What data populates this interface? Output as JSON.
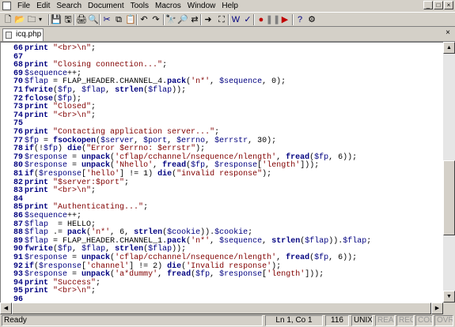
{
  "menu": [
    "File",
    "Edit",
    "Search",
    "Document",
    "Tools",
    "Macros",
    "Window",
    "Help"
  ],
  "window_controls": [
    "_",
    "□",
    "×"
  ],
  "tab": {
    "label": "icq.php",
    "close": "×"
  },
  "toolbar": {
    "icons": [
      "new-file-icon",
      "open-folder-icon",
      "open-project-icon",
      "open-dropdown-icon",
      "save-icon",
      "save-all-icon",
      "print-icon",
      "print-preview-icon",
      "cut-icon",
      "copy-icon",
      "paste-icon",
      "undo-icon",
      "redo-icon",
      "find-icon",
      "find-next-icon",
      "replace-icon",
      "goto-icon",
      "fullscreen-icon",
      "word-wrap-icon",
      "spell-check-icon",
      "record-macro-icon",
      "pause-macro-icon",
      "play-macro-icon",
      "help-icon",
      "settings-icon"
    ],
    "glyphs": [
      "🗋",
      "📂",
      "🗀",
      "▾",
      "💾",
      "🖫",
      "🖨",
      "🔍",
      "✂",
      "⧉",
      "📋",
      "↶",
      "↷",
      "🔭",
      "🔎",
      "⇄",
      "➜",
      "⛶",
      "W",
      "✓",
      "●",
      "❚❚",
      "▶",
      "?",
      "⚙"
    ]
  },
  "code_lines": [
    {
      "n": "66",
      "code": "print \"<br>\\n\";"
    },
    {
      "n": "67",
      "code": ""
    },
    {
      "n": "68",
      "code": "print \"Closing connection...\";"
    },
    {
      "n": "69",
      "code": "$sequence++;"
    },
    {
      "n": "70",
      "code": "$flap = FLAP_HEADER.CHANNEL_4.pack('n*', $sequence, 0);"
    },
    {
      "n": "71",
      "code": "fwrite($fp, $flap, strlen($flap));"
    },
    {
      "n": "72",
      "code": "fclose($fp);"
    },
    {
      "n": "73",
      "code": "print \"Closed\";"
    },
    {
      "n": "74",
      "code": "print \"<br>\\n\";"
    },
    {
      "n": "75",
      "code": ""
    },
    {
      "n": "76",
      "code": "print \"Contacting application server...\";"
    },
    {
      "n": "77",
      "code": "$fp = fsockopen($server, $port, $errno, $errstr, 30);"
    },
    {
      "n": "78",
      "code": "if(!$fp) die(\"Error $errno: $errstr\");"
    },
    {
      "n": "79",
      "code": "$response = unpack('cflap/cchannel/nsequence/nlength', fread($fp, 6));"
    },
    {
      "n": "80",
      "code": "$response = unpack('Nhello', fread($fp, $response['length']));"
    },
    {
      "n": "81",
      "code": "if($response['hello'] != 1) die(\"invalid response\");"
    },
    {
      "n": "82",
      "code": "print \"$server:$port\";"
    },
    {
      "n": "83",
      "code": "print \"<br>\\n\";"
    },
    {
      "n": "84",
      "code": ""
    },
    {
      "n": "85",
      "code": "print \"Authenticating...\";"
    },
    {
      "n": "86",
      "code": "$sequence++;"
    },
    {
      "n": "87",
      "code": "$flap  = HELLO;"
    },
    {
      "n": "88",
      "code": "$flap .= pack('n*', 6, strlen($cookie)).$cookie;"
    },
    {
      "n": "89",
      "code": "$flap = FLAP_HEADER.CHANNEL_1.pack('n*', $sequence, strlen($flap)).$flap;"
    },
    {
      "n": "90",
      "code": "fwrite($fp, $flap, strlen($flap));"
    },
    {
      "n": "91",
      "code": "$response = unpack('cflap/cchannel/nsequence/nlength', fread($fp, 6));"
    },
    {
      "n": "92",
      "code": "if($response['channel'] != 2) die('Invalid response');"
    },
    {
      "n": "93",
      "code": "$response = unpack('a*dummy', fread($fp, $response['length']));"
    },
    {
      "n": "94",
      "code": "print \"Success\";"
    },
    {
      "n": "95",
      "code": "print \"<br>\\n\";"
    },
    {
      "n": "96",
      "code": ""
    }
  ],
  "status": {
    "ready": "Ready",
    "position": "Ln 1, Co 1",
    "chars": "116",
    "unix": "UNIX",
    "read": "READ",
    "rec": "REC",
    "col": "COL",
    "ovr": "OVR"
  },
  "scroll_arrows": {
    "up": "▲",
    "down": "▼",
    "left": "◀",
    "right": "▶"
  }
}
